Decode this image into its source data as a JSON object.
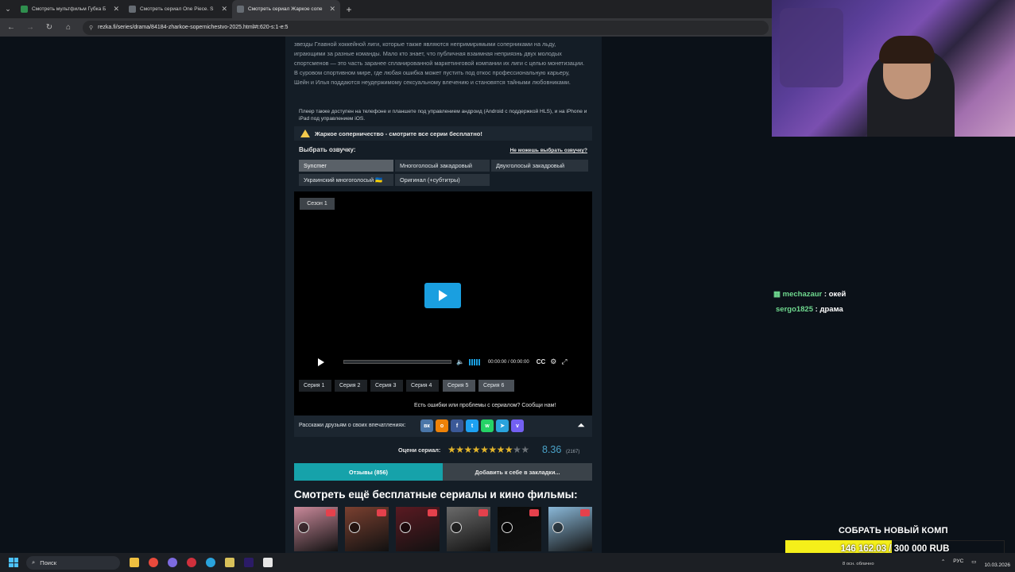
{
  "browser": {
    "tabs": [
      {
        "title": "Смотреть мультфильм Губка Б",
        "color": "#2f8f4e",
        "active": false
      },
      {
        "title": "Смотреть сериал One Piece. S",
        "color": "#666c73",
        "active": false
      },
      {
        "title": "Смотреть сериал Жаркое сопе",
        "color": "#666c73",
        "active": true
      }
    ],
    "url": "rezka.fi/series/drama/84184-zharkoe-sopernichestvo-2025.html#t:620-s:1-e:5"
  },
  "page": {
    "description": "звезды Главной хоккейной лиги, которые также являются непримиримыми соперниками на льду, играющими за разные команды. Мало кто знает, что публичная взаимная неприязнь двух молодых спортсменов — это часть заранее спланированной маркетинговой компании их лиги с целью монетизации. В суровом спортивном мире, где любая ошибка может пустить под откос профессиональную карьеру, Шейн и Илья поддаются неудержимому сексуальному влечению и становятся тайными любовниками.",
    "player_note": "Плеер также доступен на телефоне и планшете под управлением андроид (Android с поддержкой HLS), и на iPhone и iPad под управлением iOS.",
    "warning": "Жаркое соперничество - смотрите все серии бесплатно!",
    "dub_heading": "Выбрать озвучку:",
    "dub_help": "Не можешь выбрать озвучку?",
    "dubs": [
      "Syncmer",
      "Многоголосый закадровый",
      "Двухголосый закадровый",
      "Украинский многоголосый 🇺🇦",
      "Оригинал (+субтитры)"
    ],
    "season": "Сезон 1",
    "player_time": "00:00:00 / 00:00:00",
    "cc": "CC",
    "episodes": [
      "Серия 1",
      "Серия 2",
      "Серия 3",
      "Серия 4",
      "Серия 5",
      "Серия 6"
    ],
    "report": "Есть ошибки или проблемы с сериалом? Сообщи нам!",
    "share_label": "Расскажи друзьям о своих впечатлениях:",
    "social": [
      {
        "name": "vk",
        "glyph": "вк",
        "color": "#4a76a8"
      },
      {
        "name": "ok",
        "glyph": "о",
        "color": "#ee8208"
      },
      {
        "name": "facebook",
        "glyph": "f",
        "color": "#3b5998"
      },
      {
        "name": "twitter",
        "glyph": "t",
        "color": "#1da1f2"
      },
      {
        "name": "whatsapp",
        "glyph": "w",
        "color": "#25d366"
      },
      {
        "name": "telegram",
        "glyph": "➤",
        "color": "#2aa3dc"
      },
      {
        "name": "viber",
        "glyph": "v",
        "color": "#7360f2"
      }
    ],
    "rating_label": "Оцени сериал:",
    "rating": "8.36",
    "votes": "(2167)",
    "stars_filled": 8.36,
    "reviews_button": "Отзывы (856)",
    "bookmark_button": "Добавить к себе в закладки...",
    "more_heading": "Смотреть ещё бесплатные сериалы и кино фильмы:",
    "thumb_colors": [
      "#c9899a",
      "#7a4030",
      "#5a1a22",
      "#6a6a6a",
      "#0a0a0a",
      "#8ab8d8"
    ]
  },
  "stream": {
    "chat": [
      {
        "user": "mechazaur",
        "message": ": окей"
      },
      {
        "user": "sergo1825",
        "message": ": драма"
      }
    ],
    "donate_title": "СОБРАТЬ НОВЫЙ КОМП",
    "donate_progress": "146 162.03 / 300 000 RUB",
    "donate_fraction": 0.487
  },
  "taskbar": {
    "search": "Поиск",
    "weather": "8 осн. облачно",
    "lang": "РУС",
    "date": "10.03.2026"
  }
}
